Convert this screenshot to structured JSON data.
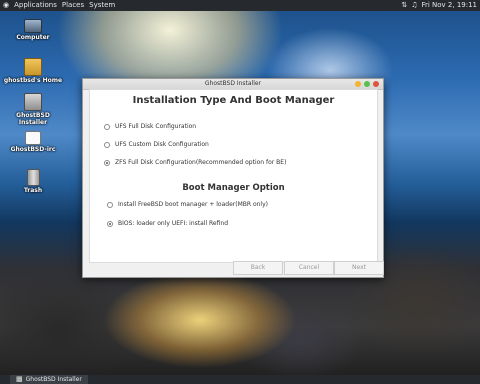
{
  "topbar": {
    "menu": [
      "Applications",
      "Places",
      "System"
    ],
    "clock": "Fri Nov 2, 19:11"
  },
  "desktop_icons": [
    {
      "label": "Computer",
      "icon": "computer-icon"
    },
    {
      "label": "ghostbsd's Home",
      "icon": "home-folder-icon"
    },
    {
      "label": "GhostBSD Installer",
      "icon": "installer-icon"
    },
    {
      "label": "GhostBSD-irc",
      "icon": "irc-chat-icon"
    },
    {
      "label": "Trash",
      "icon": "trash-icon"
    }
  ],
  "window": {
    "title": "GhostBSD Installer",
    "heading": "Installation Type And Boot Manager",
    "install_options": [
      {
        "label": "UFS Full Disk Configuration",
        "selected": false
      },
      {
        "label": "UFS Custom Disk Configuration",
        "selected": false
      },
      {
        "label": "ZFS Full Disk Configuration(Recommended option for BE)",
        "selected": true
      }
    ],
    "boot_heading": "Boot Manager Option",
    "boot_options": [
      {
        "label": "Install FreeBSD boot manager + loader(MBR only)",
        "selected": false
      },
      {
        "label": "BIOS: loader only UEFI: install Refind",
        "selected": true
      }
    ],
    "buttons": {
      "back": "Back",
      "cancel": "Cancel",
      "next": "Next"
    },
    "title_dot_colors": [
      "#f2b431",
      "#5bbf4a",
      "#e0543c"
    ]
  },
  "taskbar": {
    "task_label": "GhostBSD Installer"
  }
}
